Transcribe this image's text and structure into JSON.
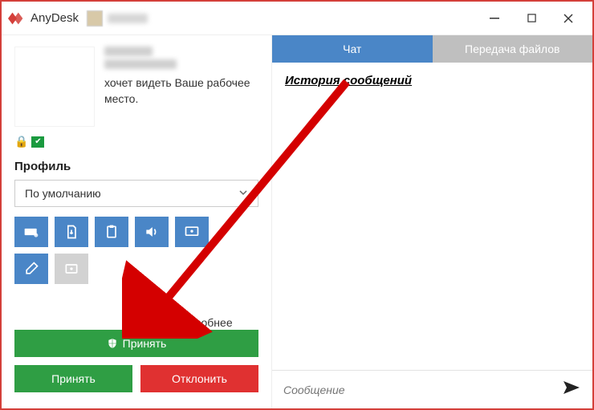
{
  "app": {
    "name": "AnyDesk"
  },
  "request": {
    "message": "хочет видеть Ваше рабочее место."
  },
  "profile": {
    "section_title": "Профиль",
    "selected": "По умолчанию",
    "more": "Подробнее"
  },
  "actions": {
    "accept_main": "Принять",
    "accept": "Принять",
    "reject": "Отклонить"
  },
  "tabs": {
    "chat": "Чат",
    "files": "Передача файлов"
  },
  "chat": {
    "history_title": "История сообщений",
    "placeholder": "Сообщение"
  }
}
